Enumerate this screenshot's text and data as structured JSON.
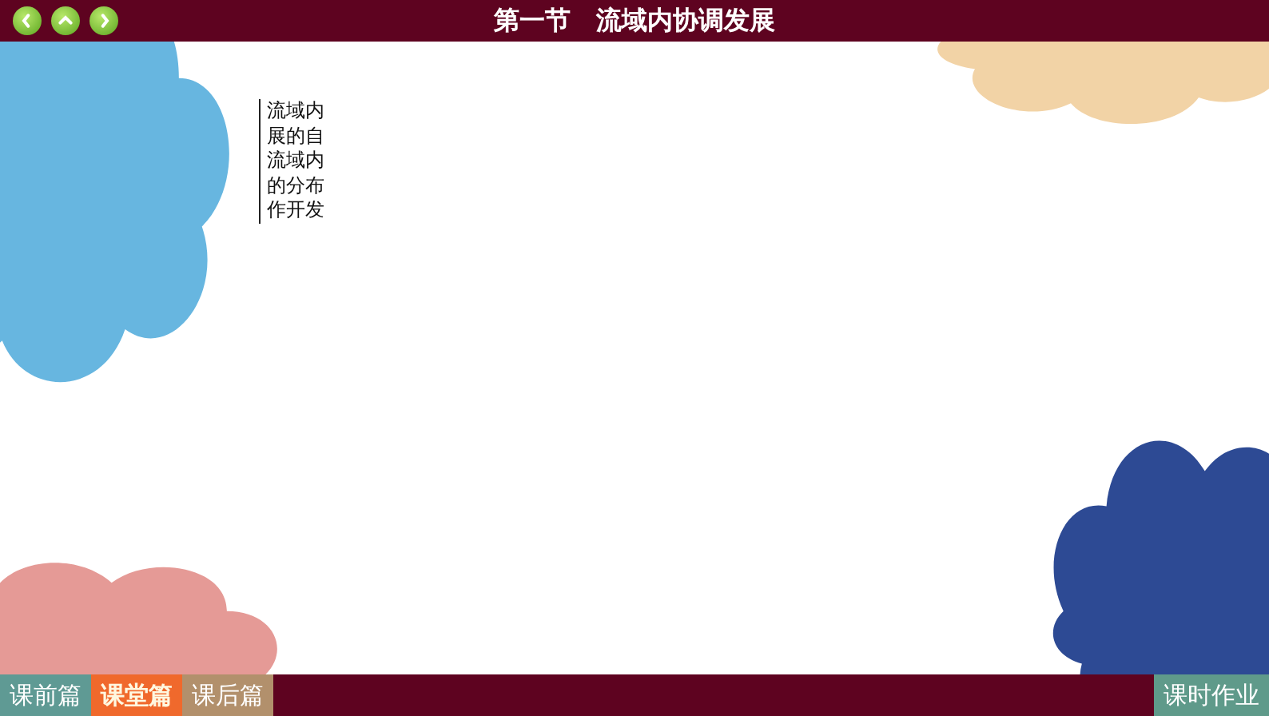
{
  "title_bar": {
    "nav_buttons": [
      {
        "kind": "back"
      },
      {
        "kind": "up"
      },
      {
        "kind": "forward"
      }
    ],
    "title": "第一节　流域内协调发展"
  },
  "slide": {
    "text_lines": [
      "流域内",
      "展的自",
      "流域内",
      "的分布",
      "作开发"
    ]
  },
  "bottom_bar": {
    "tabs": [
      {
        "label": "课前篇",
        "selected": false,
        "color": "#5f9a94"
      },
      {
        "label": "课堂篇",
        "selected": true,
        "color": "#f0692c"
      },
      {
        "label": "课后篇",
        "selected": false,
        "color": "#b2906c"
      }
    ],
    "homework_button": "课时作业"
  }
}
